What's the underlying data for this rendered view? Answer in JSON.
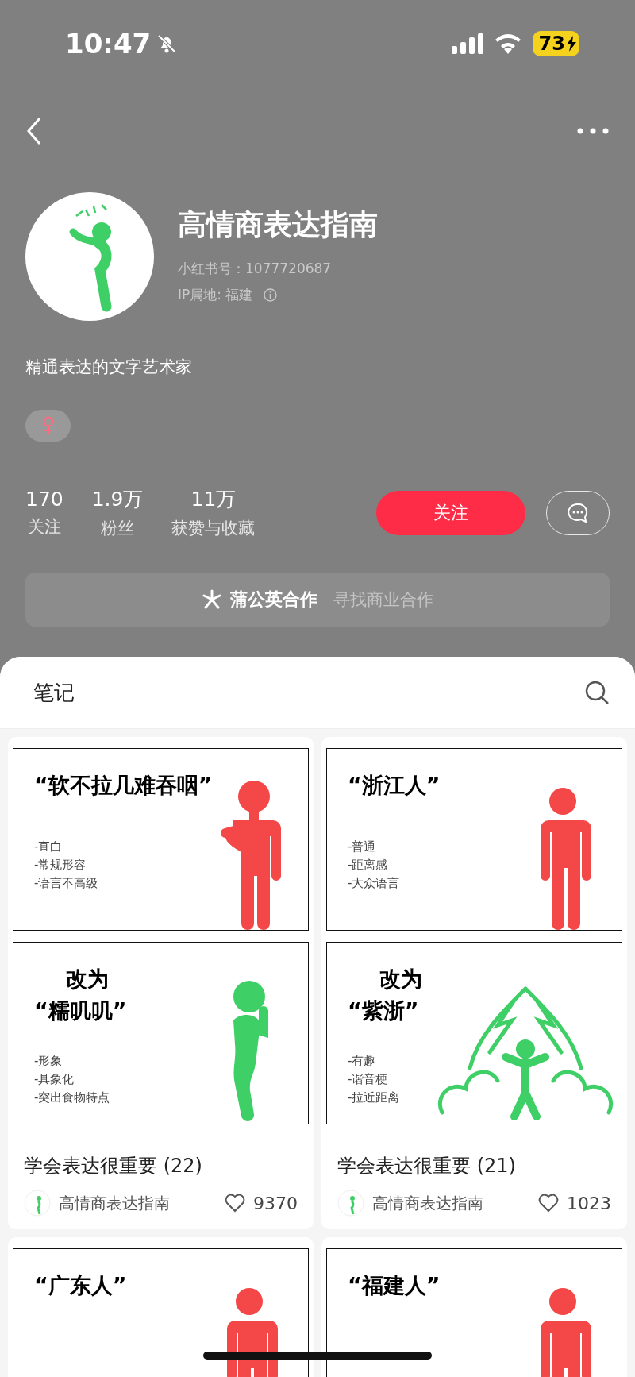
{
  "status_bar": {
    "time": "10:47",
    "battery": "73"
  },
  "profile": {
    "name": "高情商表达指南",
    "id_line": "小红书号：1077720687",
    "ip_line": "IP属地: 福建",
    "bio": "精通表达的文字艺术家",
    "stats": [
      {
        "value": "170",
        "label": "关注"
      },
      {
        "value": "1.9万",
        "label": "粉丝"
      },
      {
        "value": "11万",
        "label": "获赞与收藏"
      }
    ],
    "follow_button": "关注",
    "collab": {
      "title": "蒲公英合作",
      "subtitle": "寻找商业合作"
    }
  },
  "notes": {
    "tab": "笔记",
    "cards": [
      {
        "title": "学会表达很重要 (22)",
        "author": "高情商表达指南",
        "likes": "9370",
        "liked": false,
        "panels": [
          {
            "heading": [
              "“软不拉几难吞咽”"
            ],
            "bullets": [
              "-直白",
              "-常规形容",
              "-语言不高级"
            ],
            "kind": "choking"
          },
          {
            "heading": [
              "改为",
              "“糯叽叽”"
            ],
            "bullets": [
              "-形象",
              "-具象化",
              "-突出食物特点"
            ],
            "kind": "eating"
          }
        ]
      },
      {
        "title": "学会表达很重要 (21)",
        "author": "高情商表达指南",
        "likes": "1023",
        "liked": false,
        "panels": [
          {
            "heading": [
              "“浙江人”"
            ],
            "bullets": [
              "-普通",
              "-距离感",
              "-大众语言"
            ],
            "kind": "standing"
          },
          {
            "heading": [
              "改为",
              "“紫浙”"
            ],
            "bullets": [
              "-有趣",
              "-谐音梗",
              "-拉近距离"
            ],
            "kind": "aura"
          }
        ]
      },
      {
        "panels": [
          {
            "heading": [
              "“广东人”"
            ],
            "kind": "standing"
          }
        ]
      },
      {
        "panels": [
          {
            "heading": [
              "“福建人”"
            ],
            "kind": "standing"
          }
        ]
      }
    ]
  }
}
